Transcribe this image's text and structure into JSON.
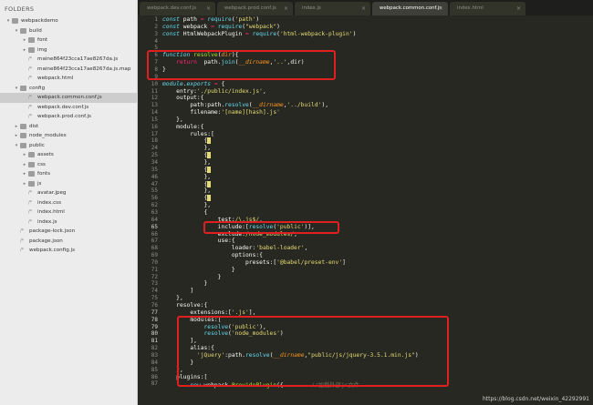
{
  "sidebar": {
    "title": "FOLDERS",
    "items": [
      {
        "label": "webpackdemo",
        "kind": "folder",
        "depth": 0,
        "open": true
      },
      {
        "label": "build",
        "kind": "folder",
        "depth": 1,
        "open": true
      },
      {
        "label": "font",
        "kind": "folder",
        "depth": 2,
        "open": false
      },
      {
        "label": "img",
        "kind": "folder",
        "depth": 2,
        "open": false
      },
      {
        "label": "maine864f23cca17ae8267da.js",
        "kind": "file",
        "depth": 2
      },
      {
        "label": "maine864f23cca17ae8267da.js.map",
        "kind": "file",
        "depth": 2
      },
      {
        "label": "webpack.html",
        "kind": "file",
        "depth": 2
      },
      {
        "label": "config",
        "kind": "folder",
        "depth": 1,
        "open": true
      },
      {
        "label": "webpack.common.conf.js",
        "kind": "file",
        "depth": 2,
        "selected": true
      },
      {
        "label": "webpack.dev.conf.js",
        "kind": "file",
        "depth": 2
      },
      {
        "label": "webpack.prod.conf.js",
        "kind": "file",
        "depth": 2
      },
      {
        "label": "dist",
        "kind": "folder",
        "depth": 1,
        "open": false
      },
      {
        "label": "node_modules",
        "kind": "folder",
        "depth": 1,
        "open": false
      },
      {
        "label": "public",
        "kind": "folder",
        "depth": 1,
        "open": true
      },
      {
        "label": "assets",
        "kind": "folder",
        "depth": 2,
        "open": false
      },
      {
        "label": "css",
        "kind": "folder",
        "depth": 2,
        "open": false
      },
      {
        "label": "fonts",
        "kind": "folder",
        "depth": 2,
        "open": false
      },
      {
        "label": "js",
        "kind": "folder",
        "depth": 2,
        "open": false
      },
      {
        "label": "avatar.jpeg",
        "kind": "file",
        "depth": 2
      },
      {
        "label": "index.css",
        "kind": "file",
        "depth": 2
      },
      {
        "label": "index.html",
        "kind": "file",
        "depth": 2
      },
      {
        "label": "index.js",
        "kind": "file",
        "depth": 2
      },
      {
        "label": "package-lock.json",
        "kind": "file",
        "depth": 1
      },
      {
        "label": "package.json",
        "kind": "file",
        "depth": 1
      },
      {
        "label": "webpack.config.js",
        "kind": "file",
        "depth": 1
      }
    ]
  },
  "tabs": [
    {
      "label": "webpack.dev.conf.js",
      "active": false
    },
    {
      "label": "webpack.prod.conf.js",
      "active": false
    },
    {
      "label": "index.js",
      "active": false
    },
    {
      "label": "webpack.common.conf.js",
      "active": true
    },
    {
      "label": "index.html",
      "active": false
    }
  ],
  "editor": {
    "lines": [
      {
        "n": "1",
        "html": "<span style='color:#66d9ef;font-style:italic'>const</span> path <span style='color:#f92672'>=</span> <span style='color:#66d9ef'>require</span>(<span style='color:#e6db74'>'path'</span>)"
      },
      {
        "n": "2",
        "html": "<span style='color:#66d9ef;font-style:italic'>const</span> webpack <span style='color:#f92672'>=</span> <span style='color:#66d9ef'>require</span>(<span style='color:#e6db74'>\"webpack\"</span>)"
      },
      {
        "n": "3",
        "html": "<span style='color:#66d9ef;font-style:italic'>const</span> HtmlWebpackPlugin <span style='color:#f92672'>=</span> <span style='color:#66d9ef'>require</span>(<span style='color:#e6db74'>'html-webpack-plugin'</span>)"
      },
      {
        "n": "4",
        "html": ""
      },
      {
        "n": "5",
        "html": ""
      },
      {
        "n": "6",
        "html": "<span style='color:#66d9ef;font-style:italic'>function</span> <span style='color:#a6e22e'>resolve</span>(<span style='color:#fd971f;font-style:italic'>dir</span>){"
      },
      {
        "n": "7",
        "html": "    <span style='color:#f92672'>return</span>  path.<span style='color:#66d9ef'>join</span>(<span style='color:#fd971f;font-style:italic'>__dirname</span>,<span style='color:#e6db74'>'..'</span>,dir)"
      },
      {
        "n": "8",
        "html": "}"
      },
      {
        "n": "9",
        "html": ""
      },
      {
        "n": "10",
        "html": "<span style='color:#66d9ef;font-style:italic'>module</span>.<span style='color:#66d9ef;font-style:italic'>exports</span> <span style='color:#f92672'>=</span> {"
      },
      {
        "n": "11",
        "html": "    entry:<span style='color:#e6db74'>'./public/index.js'</span>,"
      },
      {
        "n": "12",
        "html": "    output:{"
      },
      {
        "n": "13",
        "html": "        path:path.<span style='color:#66d9ef'>resolve</span>(<span style='color:#fd971f;font-style:italic'>__dirname</span>,<span style='color:#e6db74'>'../build'</span>),"
      },
      {
        "n": "14",
        "html": "        filename:<span style='color:#e6db74'>'[name][hash].js'</span>"
      },
      {
        "n": "15",
        "html": "    },"
      },
      {
        "n": "16",
        "html": "    module:{"
      },
      {
        "n": "17",
        "html": "        rules:["
      },
      {
        "n": "18",
        "html": "            {<span style='background:#e6db74;color:#e6db74'>▬</span>"
      },
      {
        "n": "24",
        "html": "            },"
      },
      {
        "n": "25",
        "html": "            {<span style='background:#e6db74;color:#e6db74'>▬</span>"
      },
      {
        "n": "34",
        "html": "            },"
      },
      {
        "n": "35",
        "html": "            {<span style='background:#e6db74;color:#e6db74'>▬</span>"
      },
      {
        "n": "46",
        "html": "            },"
      },
      {
        "n": "47",
        "html": "            {<span style='background:#e6db74;color:#e6db74'>▬</span>"
      },
      {
        "n": "55",
        "html": "            },"
      },
      {
        "n": "56",
        "html": "            {<span style='background:#e6db74;color:#e6db74'>▬</span>"
      },
      {
        "n": "62",
        "html": "            },"
      },
      {
        "n": "63",
        "html": "            {"
      },
      {
        "n": "64",
        "html": "                test:<span style='color:#e6db74'>/\\.js$/</span>,"
      },
      {
        "n": "65",
        "html": "                include:[<span style='color:#66d9ef'>resolve</span>(<span style='color:#e6db74'>'public'</span>)],"
      },
      {
        "n": "66",
        "html": "                exclude:<span style='color:#e6db74'>/node_modules/</span>,"
      },
      {
        "n": "67",
        "html": "                use:{"
      },
      {
        "n": "68",
        "html": "                    loader:<span style='color:#e6db74'>'babel-loader'</span>,"
      },
      {
        "n": "69",
        "html": "                    options:{"
      },
      {
        "n": "70",
        "html": "                        presets:[<span style='color:#e6db74'>'@babel/preset-env'</span>]"
      },
      {
        "n": "71",
        "html": "                    }"
      },
      {
        "n": "72",
        "html": "                }"
      },
      {
        "n": "73",
        "html": "            }"
      },
      {
        "n": "74",
        "html": "        ]"
      },
      {
        "n": "75",
        "html": "    },"
      },
      {
        "n": "76",
        "html": "    resolve:{"
      },
      {
        "n": "77",
        "html": "        extensions:[<span style='color:#e6db74'>'.js'</span>],"
      },
      {
        "n": "78",
        "html": "        modules:["
      },
      {
        "n": "79",
        "html": "            <span style='color:#66d9ef'>resolve</span>(<span style='color:#e6db74'>'public'</span>),"
      },
      {
        "n": "80",
        "html": "            <span style='color:#66d9ef'>resolve</span>(<span style='color:#e6db74'>'node_modules'</span>)"
      },
      {
        "n": "81",
        "html": "        ],"
      },
      {
        "n": "82",
        "html": "        alias:{"
      },
      {
        "n": "83",
        "html": "          <span style='color:#e6db74'>'jQuery'</span>:path.<span style='color:#66d9ef'>resolve</span>(<span style='color:#fd971f;font-style:italic'>__dirname</span>,<span style='color:#e6db74'>\"public/js/jquery-3.5.1.min.js\"</span>)"
      },
      {
        "n": "84",
        "html": "        }"
      },
      {
        "n": "85",
        "html": "    },"
      },
      {
        "n": "86",
        "html": "    plugins:["
      },
      {
        "n": "87",
        "html": "        <span style='color:#66d9ef;font-style:italic'>new</span> webpack.<span style='color:#a6e22e'>ProvidePlugin</span>({        <span style='color:#75715e'>//加载外部js文件</span>"
      }
    ]
  },
  "watermark": "https://blog.csdn.net/weixin_42292991"
}
